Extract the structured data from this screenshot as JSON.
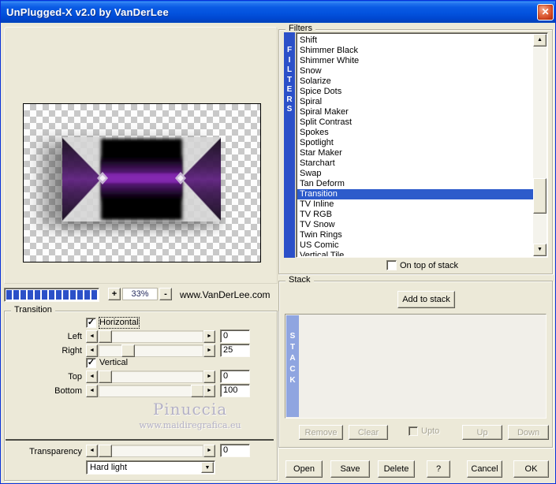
{
  "window": {
    "title": "UnPlugged-X v2.0 by VanDerLee",
    "close_glyph": "✕"
  },
  "preview": {
    "zoom_percent": "33%",
    "zoom_in_label": "+",
    "zoom_out_label": "-",
    "progress_segments": 13,
    "site_link": "www.VanDerLee.com"
  },
  "filters": {
    "group_label": "Filters",
    "side_label": "FILTERS",
    "items": [
      "Shift",
      "Shimmer Black",
      "Shimmer White",
      "Snow",
      "Solarize",
      "Spice Dots",
      "Spiral",
      "Spiral Maker",
      "Split Contrast",
      "Spokes",
      "Spotlight",
      "Star Maker",
      "Starchart",
      "Swap",
      "Tan Deform",
      "Transition",
      "TV Inline",
      "TV RGB",
      "TV Snow",
      "Twin Rings",
      "US Comic",
      "Vertical Tile"
    ],
    "selected": "Transition",
    "selected_index": 15,
    "on_top_label": "On top of stack",
    "on_top_checked": false
  },
  "stack": {
    "group_label": "Stack",
    "side_label": "STACK",
    "add_button": "Add to stack",
    "remove_button": "Remove",
    "clear_button": "Clear",
    "upto_label": "Upto",
    "upto_checked": false,
    "up_button": "Up",
    "down_button": "Down"
  },
  "transition": {
    "group_label": "Transition",
    "horizontal_label": "Horizontal",
    "horizontal_checked": true,
    "vertical_label": "Vertical",
    "vertical_checked": true,
    "sliders": [
      {
        "label": "Left",
        "value": "0",
        "position": 0
      },
      {
        "label": "Right",
        "value": "25",
        "position": 25
      },
      {
        "label": "Top",
        "value": "0",
        "position": 0
      },
      {
        "label": "Bottom",
        "value": "100",
        "position": 100
      }
    ],
    "transparency": {
      "label": "Transparency",
      "value": "0",
      "position": 0
    },
    "blend_mode": "Hard light"
  },
  "watermark": {
    "name": "Pinuccia",
    "url": "www.maidiregrafica.eu"
  },
  "actions": {
    "open": "Open",
    "save": "Save",
    "delete": "Delete",
    "help": "?",
    "cancel": "Cancel",
    "ok": "OK"
  },
  "colors": {
    "dialog_bg": "#ECE9D8",
    "selection_blue": "#2D5BCB",
    "filters_bar_blue": "#2B50C8",
    "stack_bar_blue": "#8FA5E0",
    "progress_blue": "#2B50C8",
    "preview_purple": "#7A26A4"
  }
}
